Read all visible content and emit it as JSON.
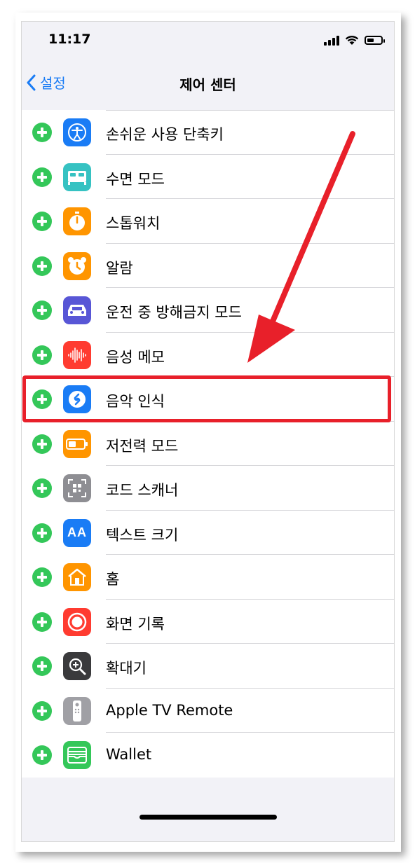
{
  "status_bar": {
    "time": "11:17"
  },
  "nav": {
    "back_label": "설정",
    "title": "제어 센터"
  },
  "items": [
    {
      "label": "손쉬운 사용 단축키",
      "icon": "accessibility-icon",
      "color": "#1a7cf5"
    },
    {
      "label": "수면 모드",
      "icon": "bed-icon",
      "color": "#36c2c2"
    },
    {
      "label": "스톱워치",
      "icon": "stopwatch-icon",
      "color": "#ff9500"
    },
    {
      "label": "알람",
      "icon": "alarm-clock-icon",
      "color": "#ff9500"
    },
    {
      "label": "운전 중 방해금지 모드",
      "icon": "car-icon",
      "color": "#5856d6"
    },
    {
      "label": "음성 메모",
      "icon": "waveform-icon",
      "color": "#ff3b30"
    },
    {
      "label": "음악 인식",
      "icon": "shazam-icon",
      "color": "#1a7cf5"
    },
    {
      "label": "저전력 모드",
      "icon": "battery-icon",
      "color": "#ff9500"
    },
    {
      "label": "코드 스캐너",
      "icon": "qr-code-icon",
      "color": "#8e8e93"
    },
    {
      "label": "텍스트 크기",
      "icon": "text-size-icon",
      "color": "#1a7cf5",
      "icon_text": "AA"
    },
    {
      "label": "홈",
      "icon": "home-icon",
      "color": "#ff9500"
    },
    {
      "label": "화면 기록",
      "icon": "screen-record-icon",
      "color": "#ff3b30"
    },
    {
      "label": "확대기",
      "icon": "magnifier-icon",
      "color": "#3a3a3c"
    },
    {
      "label": "Apple TV Remote",
      "icon": "tv-remote-icon",
      "color": "#a0a0a5"
    },
    {
      "label": "Wallet",
      "icon": "wallet-icon",
      "color": "#34c759"
    }
  ],
  "highlight_color": "#e8202a"
}
